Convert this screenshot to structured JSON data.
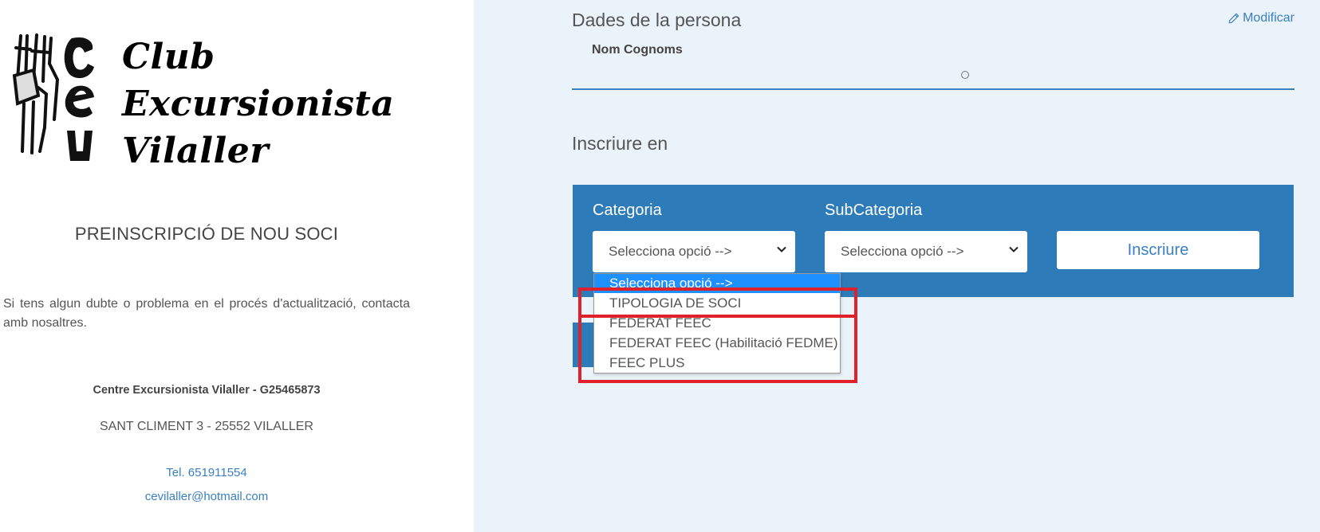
{
  "logo": {
    "lines": [
      "Club",
      "Excursionista",
      "Vilaller"
    ],
    "icon": "cev-logo-drawing-icon"
  },
  "left": {
    "title": "PREINSCRIPCIÓ DE NOU SOCI",
    "description": "Si tens algun dubte o problema en el procés d'actualització, contacta amb nosaltres.",
    "organization": "Centre Excursionista Vilaller - G25465873",
    "address": "SANT CLIMENT 3 - 25552 VILALLER",
    "phone": "Tel. 651911554",
    "email": "cevilaller@hotmail.com"
  },
  "person": {
    "section_title": "Dades de la persona",
    "modify_label": "Modificar",
    "modify_icon": "pencil-icon",
    "name_label": "Nom Cognoms"
  },
  "enroll": {
    "section_title": "Inscriure en",
    "category_label": "Categoria",
    "subcategory_label": "SubCategoria",
    "category_selected": "Selecciona opció -->",
    "subcategory_selected": "Selecciona opció -->",
    "submit_label": "Inscriure",
    "category_options": [
      "Selecciona opció -->",
      "TIPOLOGIA DE SOCI",
      "FEDERAT FEEC",
      "FEDERAT FEEC (Habilitació FEDME)",
      "FEEC PLUS"
    ]
  },
  "colors": {
    "panel_blue": "#2e7bba",
    "link_blue": "#3a7fc1",
    "right_bg": "#eaf2fa",
    "selected_option_bg": "#1e90ff",
    "highlight_red": "#e0202a"
  }
}
